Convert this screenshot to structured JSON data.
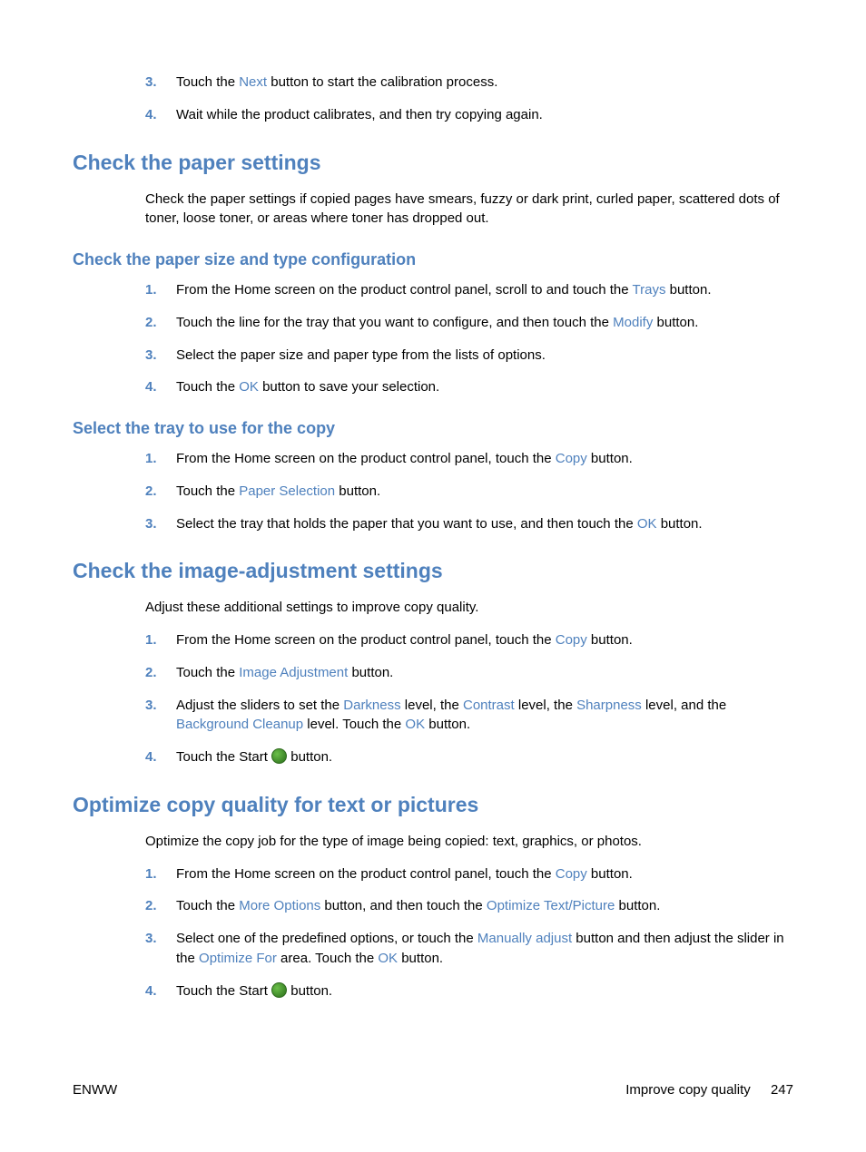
{
  "topSteps": [
    {
      "num": "3.",
      "pre": "Touch the ",
      "ui": "Next",
      "post": " button to start the calibration process."
    },
    {
      "num": "4.",
      "pre": "Wait while the product calibrates, and then try copying again.",
      "ui": "",
      "post": ""
    }
  ],
  "sec1": {
    "title": "Check the paper settings",
    "intro": "Check the paper settings if copied pages have smears, fuzzy or dark print, curled paper, scattered dots of toner, loose toner, or areas where toner has dropped out.",
    "sub1": {
      "title": "Check the paper size and type configuration",
      "steps": [
        {
          "num": "1.",
          "pre": "From the Home screen on the product control panel, scroll to and touch the ",
          "ui": "Trays",
          "post": " button."
        },
        {
          "num": "2.",
          "pre": "Touch the line for the tray that you want to configure, and then touch the ",
          "ui": "Modify",
          "post": " button."
        },
        {
          "num": "3.",
          "pre": "Select the paper size and paper type from the lists of options.",
          "ui": "",
          "post": ""
        },
        {
          "num": "4.",
          "pre": "Touch the ",
          "ui": "OK",
          "post": " button to save your selection."
        }
      ]
    },
    "sub2": {
      "title": "Select the tray to use for the copy",
      "steps": [
        {
          "num": "1.",
          "pre": "From the Home screen on the product control panel, touch the ",
          "ui": "Copy",
          "post": " button."
        },
        {
          "num": "2.",
          "pre": "Touch the ",
          "ui": "Paper Selection",
          "post": " button."
        },
        {
          "num": "3.",
          "pre": "Select the tray that holds the paper that you want to use, and then touch the ",
          "ui": "OK",
          "post": " button."
        }
      ]
    }
  },
  "sec2": {
    "title": "Check the image-adjustment settings",
    "intro": "Adjust these additional settings to improve copy quality.",
    "s1": {
      "num": "1.",
      "pre": "From the Home screen on the product control panel, touch the ",
      "ui": "Copy",
      "post": " button."
    },
    "s2": {
      "num": "2.",
      "pre": "Touch the ",
      "ui": "Image Adjustment",
      "post": " button."
    },
    "s3": {
      "num": "3.",
      "t1": "Adjust the sliders to set the ",
      "u1": "Darkness",
      "t2": " level, the ",
      "u2": "Contrast",
      "t3": " level, the ",
      "u3": "Sharpness",
      "t4": " level, and the ",
      "u4": "Background Cleanup",
      "t5": " level. Touch the ",
      "u5": "OK",
      "t6": " button."
    },
    "s4": {
      "num": "4.",
      "pre": "Touch the Start ",
      "post": " button."
    }
  },
  "sec3": {
    "title": "Optimize copy quality for text or pictures",
    "intro": "Optimize the copy job for the type of image being copied: text, graphics, or photos.",
    "s1": {
      "num": "1.",
      "pre": "From the Home screen on the product control panel, touch the ",
      "ui": "Copy",
      "post": " button."
    },
    "s2": {
      "num": "2.",
      "t1": "Touch the ",
      "u1": "More Options",
      "t2": " button, and then touch the ",
      "u2": "Optimize Text/Picture",
      "t3": " button."
    },
    "s3": {
      "num": "3.",
      "t1": "Select one of the predefined options, or touch the ",
      "u1": "Manually adjust",
      "t2": " button and then adjust the slider in the ",
      "u2": "Optimize For",
      "t3": " area. Touch the ",
      "u3": "OK",
      "t4": " button."
    },
    "s4": {
      "num": "4.",
      "pre": "Touch the Start ",
      "post": " button."
    }
  },
  "footer": {
    "left": "ENWW",
    "rightText": "Improve copy quality",
    "pageNum": "247"
  }
}
